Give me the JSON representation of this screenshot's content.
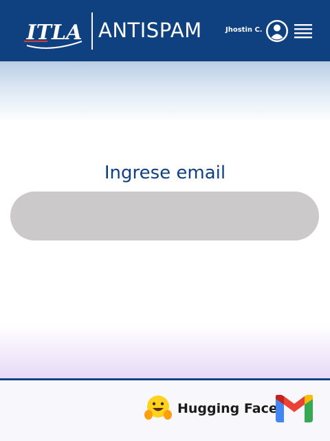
{
  "header": {
    "logo_text": "ITLA",
    "app_title": "ANTISPAM",
    "user_name": "Jhostin C.",
    "avatar_icon": "user-circle-icon",
    "menu_icon": "hamburger-menu-icon",
    "background_color": "#0f4181"
  },
  "main": {
    "prompt": "Ingrese email",
    "email_input": {
      "value": "",
      "placeholder": ""
    }
  },
  "footer": {
    "brands": [
      {
        "name": "Hugging Face",
        "icon": "hugging-face-icon"
      },
      {
        "name": "Gmail",
        "icon": "gmail-icon"
      }
    ]
  },
  "colors": {
    "primary": "#0f4181",
    "input_background": "#cbc9ca"
  }
}
